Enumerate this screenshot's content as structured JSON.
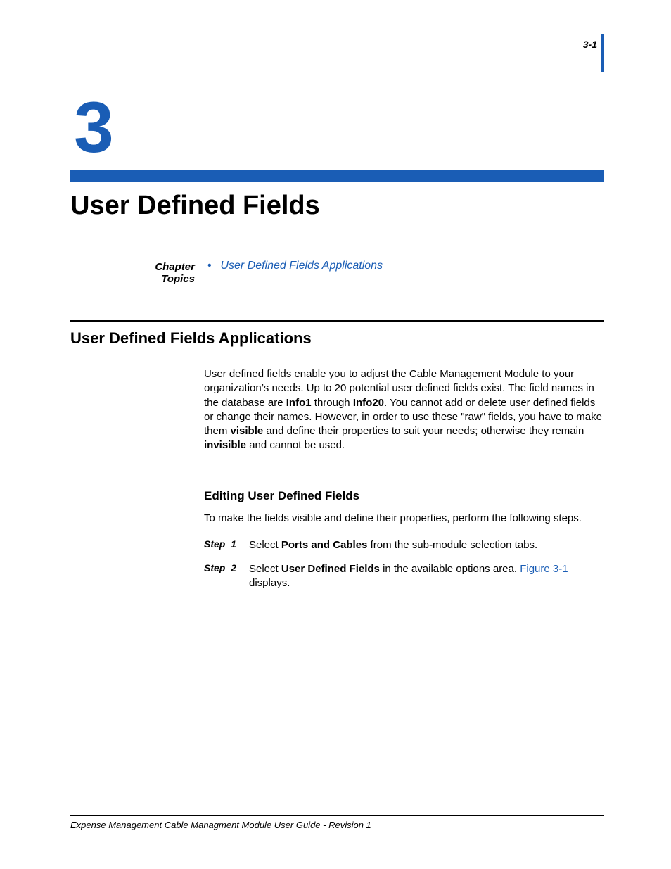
{
  "page_number": "3-1",
  "chapter_number": "3",
  "chapter_title": "User Defined Fields",
  "topics_label": "Chapter Topics",
  "topics": [
    {
      "label": "User Defined Fields Applications"
    }
  ],
  "section": {
    "heading": "User Defined Fields Applications",
    "paragraph_parts": {
      "p1a": "User defined fields enable you to adjust the Cable Management Module to your organization’s needs. Up to 20 potential user defined fields exist. The field names in the database are ",
      "b1": "Info1",
      "p1b": " through ",
      "b2": "Info20",
      "p1c": ". You cannot add or delete user defined fields or change their names. However, in order to use these \"raw\" fields, you have to make them ",
      "b3": "visible",
      "p1d": " and define their properties to suit your needs; otherwise they remain ",
      "b4": "invisible",
      "p1e": " and cannot be used."
    },
    "subheading": "Editing User Defined Fields",
    "sub_intro": "To make the fields visible and define their properties, perform the following steps.",
    "steps": [
      {
        "label": "Step  1",
        "pre": "Select ",
        "bold": "Ports and Cables",
        "post": " from the sub-module selection tabs.",
        "link": "",
        "tail": ""
      },
      {
        "label": "Step  2",
        "pre": "Select ",
        "bold": "User Defined Fields",
        "post": " in the available options area. ",
        "link": "Figure 3-1",
        "tail": " displays."
      }
    ]
  },
  "footer": "Expense Management Cable Managment Module User Guide - Revision 1"
}
